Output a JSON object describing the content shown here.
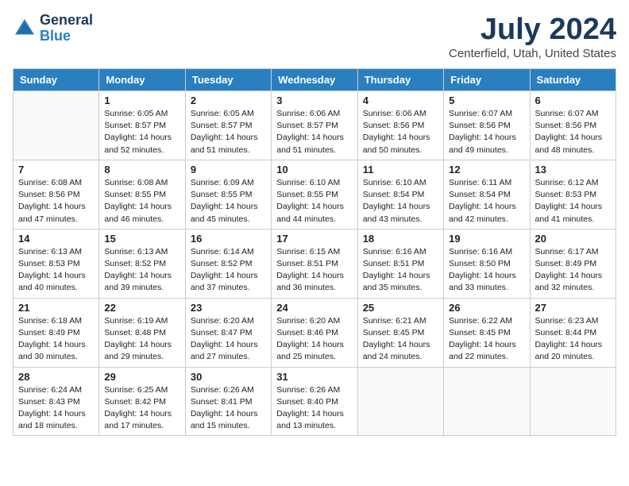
{
  "header": {
    "logo_general": "General",
    "logo_blue": "Blue",
    "month_title": "July 2024",
    "location": "Centerfield, Utah, United States"
  },
  "days_of_week": [
    "Sunday",
    "Monday",
    "Tuesday",
    "Wednesday",
    "Thursday",
    "Friday",
    "Saturday"
  ],
  "weeks": [
    [
      {
        "day": "",
        "content": ""
      },
      {
        "day": "1",
        "content": "Sunrise: 6:05 AM\nSunset: 8:57 PM\nDaylight: 14 hours\nand 52 minutes."
      },
      {
        "day": "2",
        "content": "Sunrise: 6:05 AM\nSunset: 8:57 PM\nDaylight: 14 hours\nand 51 minutes."
      },
      {
        "day": "3",
        "content": "Sunrise: 6:06 AM\nSunset: 8:57 PM\nDaylight: 14 hours\nand 51 minutes."
      },
      {
        "day": "4",
        "content": "Sunrise: 6:06 AM\nSunset: 8:56 PM\nDaylight: 14 hours\nand 50 minutes."
      },
      {
        "day": "5",
        "content": "Sunrise: 6:07 AM\nSunset: 8:56 PM\nDaylight: 14 hours\nand 49 minutes."
      },
      {
        "day": "6",
        "content": "Sunrise: 6:07 AM\nSunset: 8:56 PM\nDaylight: 14 hours\nand 48 minutes."
      }
    ],
    [
      {
        "day": "7",
        "content": "Sunrise: 6:08 AM\nSunset: 8:56 PM\nDaylight: 14 hours\nand 47 minutes."
      },
      {
        "day": "8",
        "content": "Sunrise: 6:08 AM\nSunset: 8:55 PM\nDaylight: 14 hours\nand 46 minutes."
      },
      {
        "day": "9",
        "content": "Sunrise: 6:09 AM\nSunset: 8:55 PM\nDaylight: 14 hours\nand 45 minutes."
      },
      {
        "day": "10",
        "content": "Sunrise: 6:10 AM\nSunset: 8:55 PM\nDaylight: 14 hours\nand 44 minutes."
      },
      {
        "day": "11",
        "content": "Sunrise: 6:10 AM\nSunset: 8:54 PM\nDaylight: 14 hours\nand 43 minutes."
      },
      {
        "day": "12",
        "content": "Sunrise: 6:11 AM\nSunset: 8:54 PM\nDaylight: 14 hours\nand 42 minutes."
      },
      {
        "day": "13",
        "content": "Sunrise: 6:12 AM\nSunset: 8:53 PM\nDaylight: 14 hours\nand 41 minutes."
      }
    ],
    [
      {
        "day": "14",
        "content": "Sunrise: 6:13 AM\nSunset: 8:53 PM\nDaylight: 14 hours\nand 40 minutes."
      },
      {
        "day": "15",
        "content": "Sunrise: 6:13 AM\nSunset: 8:52 PM\nDaylight: 14 hours\nand 39 minutes."
      },
      {
        "day": "16",
        "content": "Sunrise: 6:14 AM\nSunset: 8:52 PM\nDaylight: 14 hours\nand 37 minutes."
      },
      {
        "day": "17",
        "content": "Sunrise: 6:15 AM\nSunset: 8:51 PM\nDaylight: 14 hours\nand 36 minutes."
      },
      {
        "day": "18",
        "content": "Sunrise: 6:16 AM\nSunset: 8:51 PM\nDaylight: 14 hours\nand 35 minutes."
      },
      {
        "day": "19",
        "content": "Sunrise: 6:16 AM\nSunset: 8:50 PM\nDaylight: 14 hours\nand 33 minutes."
      },
      {
        "day": "20",
        "content": "Sunrise: 6:17 AM\nSunset: 8:49 PM\nDaylight: 14 hours\nand 32 minutes."
      }
    ],
    [
      {
        "day": "21",
        "content": "Sunrise: 6:18 AM\nSunset: 8:49 PM\nDaylight: 14 hours\nand 30 minutes."
      },
      {
        "day": "22",
        "content": "Sunrise: 6:19 AM\nSunset: 8:48 PM\nDaylight: 14 hours\nand 29 minutes."
      },
      {
        "day": "23",
        "content": "Sunrise: 6:20 AM\nSunset: 8:47 PM\nDaylight: 14 hours\nand 27 minutes."
      },
      {
        "day": "24",
        "content": "Sunrise: 6:20 AM\nSunset: 8:46 PM\nDaylight: 14 hours\nand 25 minutes."
      },
      {
        "day": "25",
        "content": "Sunrise: 6:21 AM\nSunset: 8:45 PM\nDaylight: 14 hours\nand 24 minutes."
      },
      {
        "day": "26",
        "content": "Sunrise: 6:22 AM\nSunset: 8:45 PM\nDaylight: 14 hours\nand 22 minutes."
      },
      {
        "day": "27",
        "content": "Sunrise: 6:23 AM\nSunset: 8:44 PM\nDaylight: 14 hours\nand 20 minutes."
      }
    ],
    [
      {
        "day": "28",
        "content": "Sunrise: 6:24 AM\nSunset: 8:43 PM\nDaylight: 14 hours\nand 18 minutes."
      },
      {
        "day": "29",
        "content": "Sunrise: 6:25 AM\nSunset: 8:42 PM\nDaylight: 14 hours\nand 17 minutes."
      },
      {
        "day": "30",
        "content": "Sunrise: 6:26 AM\nSunset: 8:41 PM\nDaylight: 14 hours\nand 15 minutes."
      },
      {
        "day": "31",
        "content": "Sunrise: 6:26 AM\nSunset: 8:40 PM\nDaylight: 14 hours\nand 13 minutes."
      },
      {
        "day": "",
        "content": ""
      },
      {
        "day": "",
        "content": ""
      },
      {
        "day": "",
        "content": ""
      }
    ]
  ]
}
